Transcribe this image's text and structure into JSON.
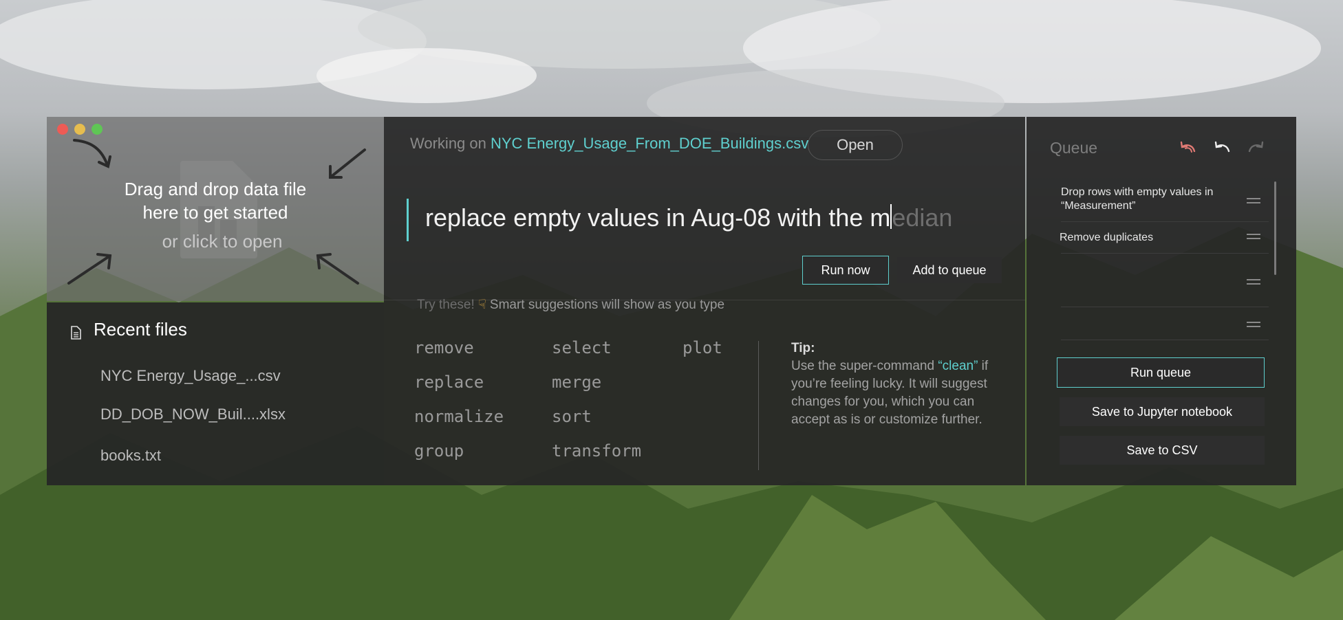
{
  "window": {
    "traffic_lights": [
      "close",
      "minimize",
      "maximize"
    ]
  },
  "drop_zone": {
    "line1": "Drag and drop data file",
    "line2": "here to get started",
    "sub": "or click to open"
  },
  "recent": {
    "title": "Recent files",
    "items": [
      {
        "label": "NYC Energy_Usage_...csv"
      },
      {
        "label": "DD_DOB_NOW_Buil....xlsx"
      },
      {
        "label": "books.txt"
      }
    ]
  },
  "main": {
    "working_prefix": "Working on",
    "working_file": "NYC Energy_Usage_From_DOE_Buildings.csv",
    "open_label": "Open",
    "command_typed": "replace empty values in Aug-08 with the m",
    "command_suggestion": "edian",
    "run_now_label": "Run now",
    "add_queue_label": "Add to queue",
    "try_prefix": "Try these!",
    "try_hint": "Smart suggestions will show as you type",
    "keywords": [
      [
        "remove",
        "replace",
        "normalize",
        "group"
      ],
      [
        "select",
        "merge",
        "sort",
        "transform"
      ],
      [
        "plot"
      ]
    ],
    "tip": {
      "label": "Tip:",
      "before": "Use the super-command ",
      "command": "“clean”",
      "after": " if you’re feeling lucky. It will suggest changes for you, which you can accept as is or customize further."
    }
  },
  "queue": {
    "title": "Queue",
    "items": [
      {
        "label": "Drop rows with empty values in “Measurement”"
      },
      {
        "label": "Remove duplicates"
      },
      {
        "label": ""
      },
      {
        "label": ""
      }
    ],
    "run_label": "Run queue",
    "save_jupyter_label": "Save to Jupyter notebook",
    "save_csv_label": "Save to CSV"
  },
  "colors": {
    "accent": "#5fd0cf",
    "danger_icon": "#e07a74"
  }
}
